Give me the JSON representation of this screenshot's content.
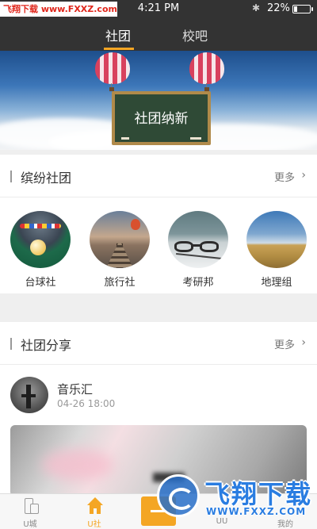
{
  "status_bar": {
    "watermark_a": "飞翔下载",
    "watermark_b": "www.FXXZ.com",
    "time": "4:21 PM",
    "battery_text": "22%",
    "battery_level": 0.22
  },
  "top_tabs": [
    {
      "label": "社团",
      "active": true
    },
    {
      "label": "校吧",
      "active": false
    }
  ],
  "banner": {
    "board_text": "社团纳新"
  },
  "clubs_section": {
    "title": "缤纷社团",
    "more": "更多",
    "items": [
      {
        "label": "台球社",
        "icon": "billiards-photo"
      },
      {
        "label": "旅行社",
        "icon": "railway-balloon-photo"
      },
      {
        "label": "考研邦",
        "icon": "glasses-photo"
      },
      {
        "label": "地理组",
        "icon": "field-sky-photo"
      }
    ]
  },
  "share_section": {
    "title": "社团分享",
    "more": "更多",
    "post": {
      "author": "音乐汇",
      "time": "04-26 18:00"
    }
  },
  "tab_bar": {
    "items": [
      {
        "label": "U城",
        "icon": "building-icon",
        "active": false
      },
      {
        "label": "U社",
        "icon": "home-icon",
        "active": true
      },
      {
        "label": "UU",
        "icon": "chat-icon",
        "active": false
      },
      {
        "label": "我的",
        "icon": "profile-icon",
        "active": false
      }
    ],
    "accent": "#f4a624"
  },
  "watermark": {
    "title": "飞翔下载",
    "url": "WWW.FXXZ.COM"
  }
}
